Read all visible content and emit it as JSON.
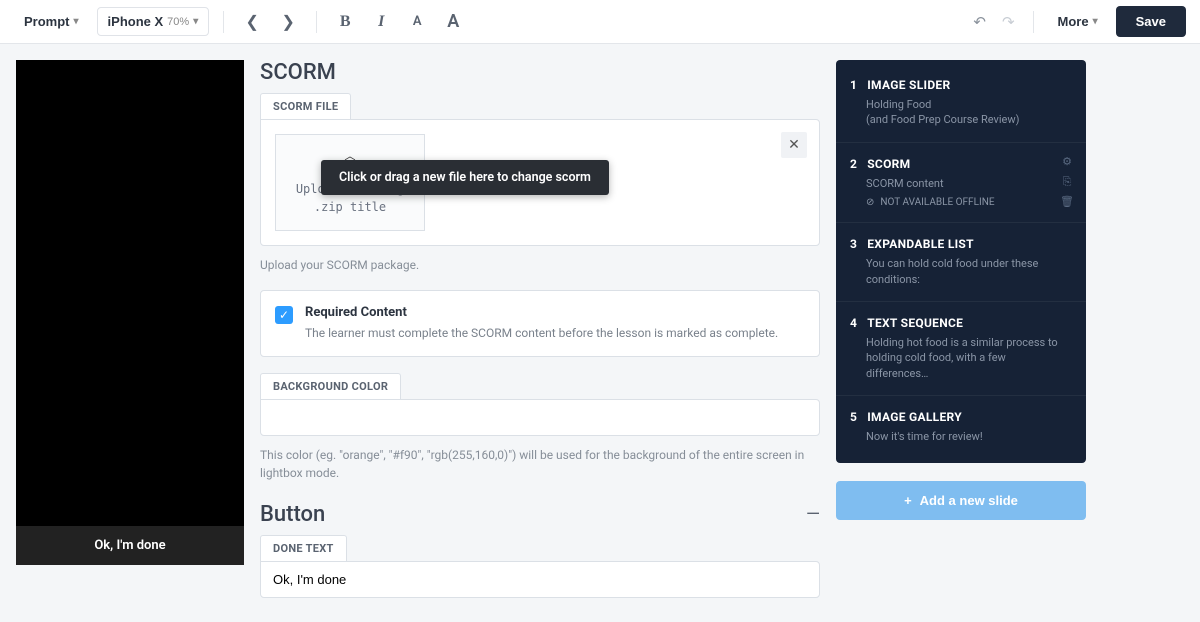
{
  "toolbar": {
    "prompt_label": "Prompt",
    "device_label": "iPhone X",
    "zoom": "70%",
    "more_label": "More",
    "save_label": "Save"
  },
  "preview": {
    "done_button": "Ok, I'm done"
  },
  "scorm": {
    "heading": "SCORM",
    "file_label": "SCORM FILE",
    "upload_line1": "Uploadersending",
    "upload_line2": ".zip title",
    "tooltip": "Click or drag a new file here to change scorm",
    "helper": "Upload your SCORM package.",
    "required_title": "Required Content",
    "required_desc": "The learner must complete the SCORM content before the lesson is marked as complete.",
    "bg_label": "BACKGROUND COLOR",
    "bg_helper": "This color (eg. \"orange\", \"#f90\", \"rgb(255,160,0)\") will be used for the background of the entire screen in lightbox mode."
  },
  "button_section": {
    "heading": "Button",
    "done_text_label": "DONE TEXT",
    "done_text_value": "Ok, I'm done"
  },
  "slides": [
    {
      "num": "1",
      "title": "IMAGE SLIDER",
      "sub": "Holding Food",
      "sub2": "(and Food Prep Course Review)"
    },
    {
      "num": "2",
      "title": "SCORM",
      "sub": "SCORM content",
      "meta": "NOT AVAILABLE OFFLINE",
      "active": true
    },
    {
      "num": "3",
      "title": "EXPANDABLE LIST",
      "sub": "You can hold cold food under these conditions:"
    },
    {
      "num": "4",
      "title": "TEXT SEQUENCE",
      "sub": "Holding hot food is a similar process to holding cold food, with a few differences…"
    },
    {
      "num": "5",
      "title": "IMAGE GALLERY",
      "sub": "Now it's time for review!"
    }
  ],
  "add_slide_label": "Add a new slide"
}
